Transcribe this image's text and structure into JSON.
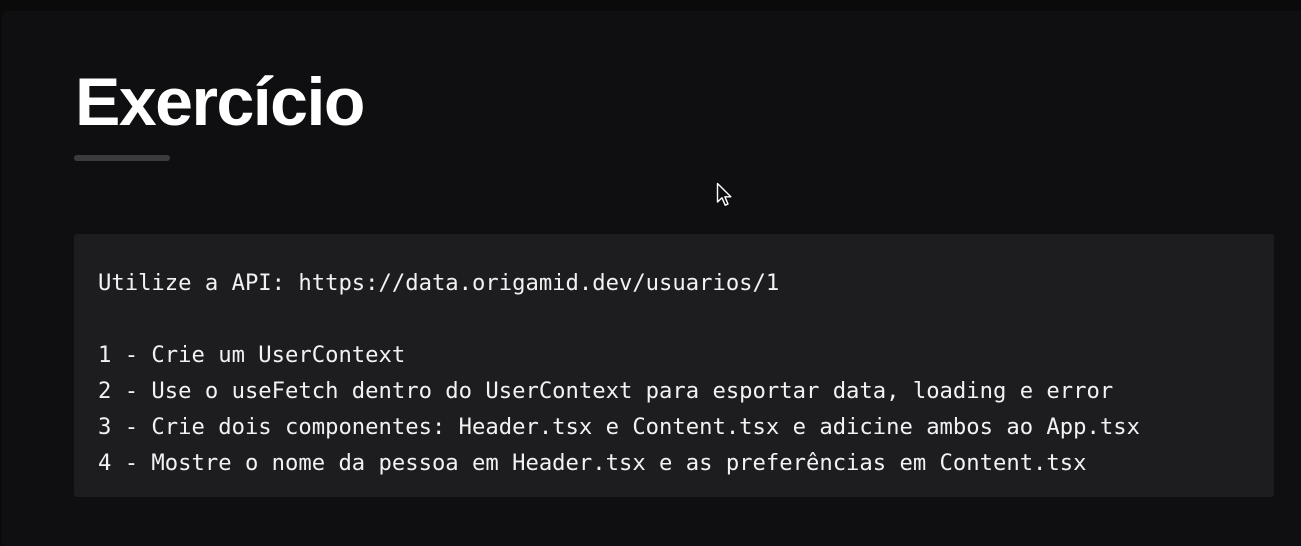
{
  "page": {
    "title": "Exercício"
  },
  "code_block": {
    "lines": [
      "Utilize a API: https://data.origamid.dev/usuarios/1",
      "",
      "1 - Crie um UserContext",
      "2 - Use o useFetch dentro do UserContext para esportar data, loading e error",
      "3 - Crie dois componentes: Header.tsx e Content.tsx e adicine ambos ao App.tsx",
      "4 - Mostre o nome da pessoa em Header.tsx e as preferências em Content.tsx"
    ]
  },
  "colors": {
    "background": "#0f0f11",
    "title": "#ffffff",
    "underline": "#3a3a3f",
    "code_background": "#1d1d20",
    "code_text": "#f2f2f2"
  },
  "icons": {
    "cursor": "mouse-pointer-icon"
  }
}
